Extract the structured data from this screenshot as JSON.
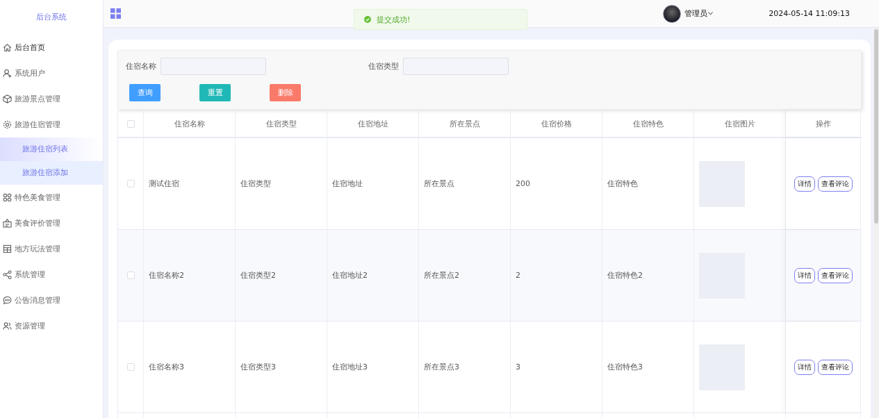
{
  "sidebar": {
    "title": "后台系统",
    "items": [
      {
        "label": "后台首页",
        "selected": true
      },
      {
        "label": "系统用户",
        "selected": false
      },
      {
        "label": "旅游景点管理",
        "selected": false
      },
      {
        "label": "旅游住宿管理",
        "selected": false,
        "children": [
          {
            "label": "旅游住宿列表",
            "selected": true,
            "hovered": false
          },
          {
            "label": "旅游住宿添加",
            "selected": false,
            "hovered": true
          }
        ]
      },
      {
        "label": "特色美食管理",
        "selected": false
      },
      {
        "label": "美食评价管理",
        "selected": false
      },
      {
        "label": "地方玩法管理",
        "selected": false
      },
      {
        "label": "系统管理",
        "selected": false
      },
      {
        "label": "公告消息管理",
        "selected": false
      },
      {
        "label": "资源管理",
        "selected": false
      }
    ]
  },
  "header": {
    "user": "管理员",
    "datetime": "2024-05-14 11:09:13"
  },
  "toast": {
    "message": "提交成功!"
  },
  "search": {
    "fields": [
      {
        "label": "住宿名称"
      },
      {
        "label": "住宿类型"
      }
    ],
    "buttons": [
      {
        "label": "查询",
        "kind": "primary"
      },
      {
        "label": "重置",
        "kind": "reset"
      },
      {
        "label": "删除",
        "kind": "danger"
      }
    ]
  },
  "table": {
    "select_all": {
      "checked": false
    },
    "columns": [
      "住宿名称",
      "住宿类型",
      "住宿地址",
      "所在景点",
      "住宿价格",
      "住宿特色",
      "住宿图片",
      "操作"
    ],
    "rows": [
      {
        "checked": false,
        "cells": [
          "测试住宿",
          "住宿类型",
          "住宿地址",
          "所在景点",
          "200",
          "住宿特色"
        ],
        "actions": [
          "详情",
          "查看评论"
        ]
      },
      {
        "checked": false,
        "cells": [
          "住宿名称2",
          "住宿类型2",
          "住宿地址2",
          "所在景点2",
          "2",
          "住宿特色2"
        ],
        "actions": [
          "详情",
          "查看评论"
        ]
      },
      {
        "checked": false,
        "cells": [
          "住宿名称3",
          "住宿类型3",
          "住宿地址3",
          "所在景点3",
          "3",
          "住宿特色3"
        ],
        "actions": [
          "详情",
          "查看评论"
        ]
      }
    ]
  }
}
